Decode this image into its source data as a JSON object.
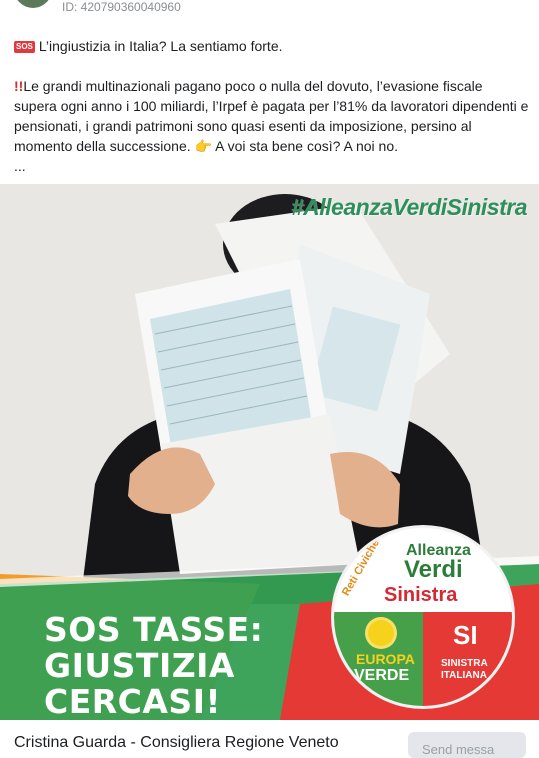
{
  "ad": {
    "id_label": "ID: 420790360040960"
  },
  "post": {
    "sos_badge": "SOS",
    "line1": "L’ingiustizia in Italia? La sentiamo forte.",
    "double_bang": "!!",
    "body": "Le grandi multinazionali pagano poco o nulla del dovuto, l’evasione fiscale supera ogni anno i 100 miliardi, l’Irpef è pagata per l’81% da lavoratori dipendenti e pensionati, i grandi patrimoni sono quasi esenti da imposizione, persino al momento della successione.",
    "pointer": "👉",
    "question": "A voi sta bene così? A noi no.",
    "ellipsis": "..."
  },
  "media": {
    "hashtag": "#AlleanzaVerdiSinistra",
    "headline": [
      "SOS TASSE:",
      "GIUSTIZIA",
      "CERCASI!"
    ],
    "logo": {
      "reti": "Reti Civiche",
      "alleanza": "Alleanza",
      "verdi": "Verdi",
      "sinistra": "Sinistra",
      "europa": "EUROPA",
      "verde": "VERDE",
      "si": "SI",
      "si_line1": "SINISTRA",
      "si_line2": "ITALIANA"
    }
  },
  "footer": {
    "page_name": "Cristina Guarda - Consigliera Regione Veneto",
    "send_button": "Send messa"
  }
}
